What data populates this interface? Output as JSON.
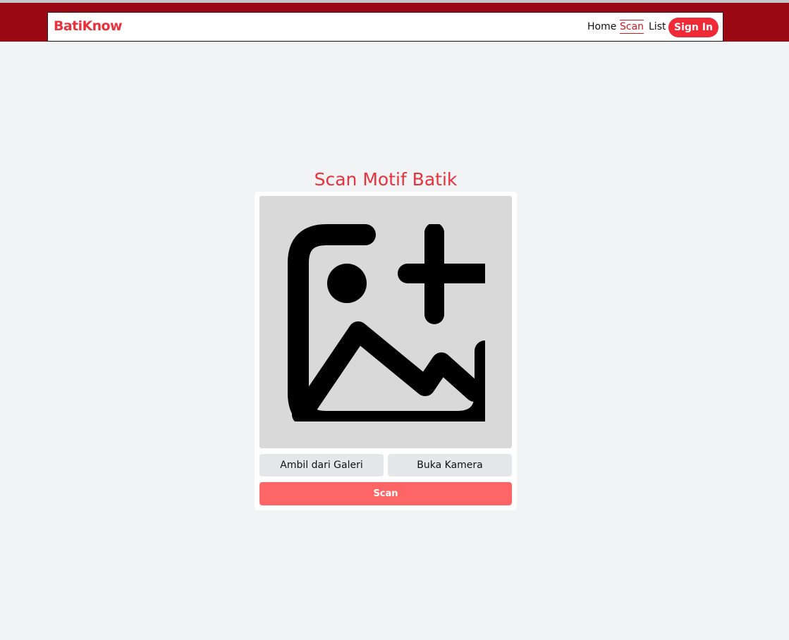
{
  "header": {
    "brand": "BatiKnow",
    "nav": {
      "home": "Home",
      "scan": "Scan",
      "list": "List",
      "sign_in": "Sign In"
    }
  },
  "main": {
    "title": "Scan Motif Batik",
    "preview_icon": "image-add-icon",
    "gallery_button": "Ambil dari Galeri",
    "camera_button": "Buka Kamera",
    "scan_button": "Scan"
  },
  "colors": {
    "header_bg": "#9b0a14",
    "brand": "#e8323c",
    "sign_in_bg": "#ef2a36",
    "scan_button_bg": "#fe6566",
    "page_bg": "#f2f3f5"
  }
}
